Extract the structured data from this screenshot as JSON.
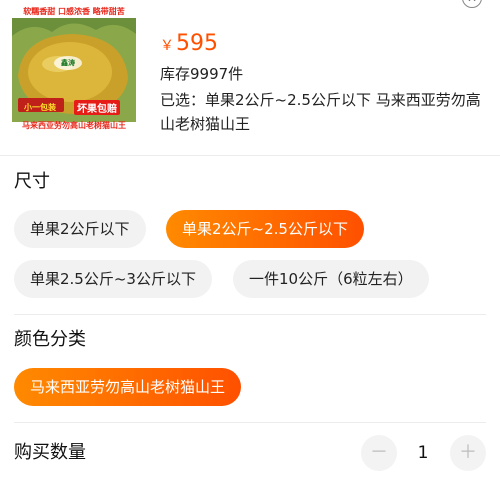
{
  "header": {
    "product_image": {
      "top_text": "软糯香甜 口感浓香 略带甜苦",
      "logo_text": "鑫涛",
      "promo_left": "小一包装",
      "promo_right": "坏果包赔",
      "bottom_text": "马来西亚劳勿高山老树猫山王"
    },
    "price_symbol": "￥",
    "price": "595",
    "stock": "库存9997件",
    "selected": "已选：单果2公斤~2.5公斤以下 马来西亚劳勿高山老树猫山王",
    "close_icon": "close-icon"
  },
  "size_section": {
    "title": "尺寸",
    "options": [
      {
        "label": "单果2公斤以下",
        "selected": false
      },
      {
        "label": "单果2公斤~2.5公斤以下",
        "selected": true
      },
      {
        "label": "单果2.5公斤~3公斤以下",
        "selected": false
      },
      {
        "label": "一件10公斤（6粒左右）",
        "selected": false
      }
    ]
  },
  "color_section": {
    "title": "颜色分类",
    "options": [
      {
        "label": "马来西亚劳勿高山老树猫山王",
        "selected": true
      }
    ]
  },
  "quantity_section": {
    "title": "购买数量",
    "minus": "－",
    "value": "1",
    "plus": "＋"
  },
  "colors": {
    "accent": "#ff5000",
    "accent_gradient_start": "#ff8a00",
    "chip_bg": "#f2f2f2"
  }
}
